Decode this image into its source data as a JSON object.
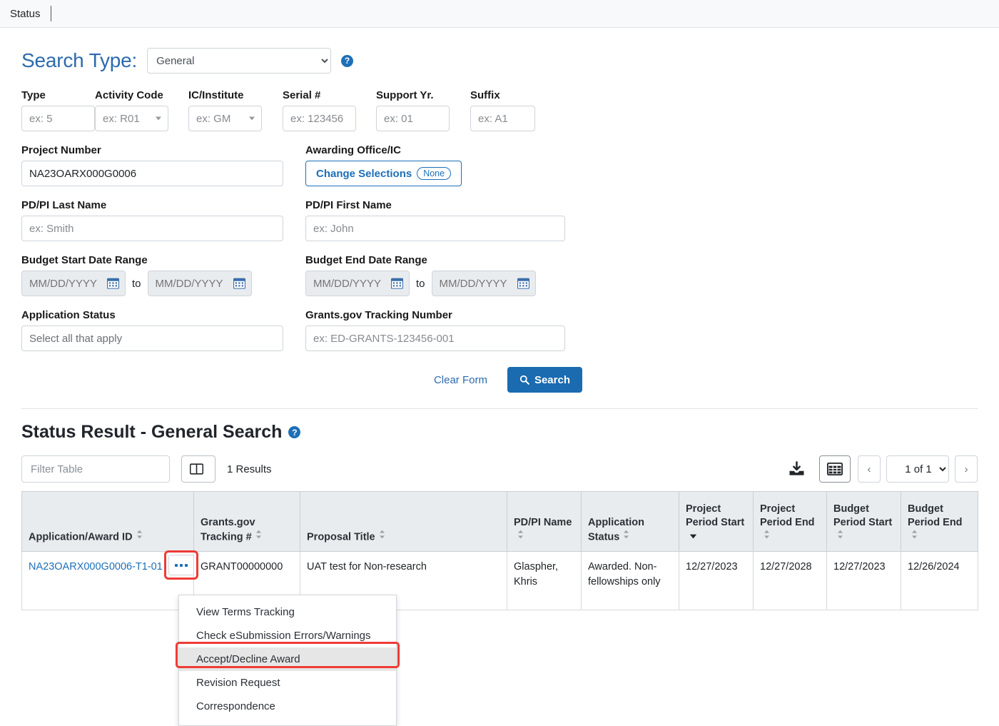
{
  "topbar": {
    "tab_label": "Status"
  },
  "search": {
    "heading": "Search Type:",
    "type_value": "General",
    "help_icon": "help-circle-icon",
    "fields": {
      "type": {
        "label": "Type",
        "placeholder": "ex: 5",
        "value": ""
      },
      "activity_code": {
        "label": "Activity Code",
        "placeholder": "ex: R01",
        "value": ""
      },
      "ic_institute": {
        "label": "IC/Institute",
        "placeholder": "ex: GM",
        "value": ""
      },
      "serial": {
        "label": "Serial #",
        "placeholder": "ex: 123456",
        "value": ""
      },
      "support_yr": {
        "label": "Support Yr.",
        "placeholder": "ex: 01",
        "value": ""
      },
      "suffix": {
        "label": "Suffix",
        "placeholder": "ex: A1",
        "value": ""
      },
      "project_number": {
        "label": "Project Number",
        "placeholder": "",
        "value": "NA23OARX000G0006"
      },
      "awarding_office": {
        "label": "Awarding Office/IC",
        "button_label": "Change Selections",
        "pill": "None"
      },
      "pdpi_last": {
        "label": "PD/PI Last Name",
        "placeholder": "ex: Smith",
        "value": ""
      },
      "pdpi_first": {
        "label": "PD/PI First Name",
        "placeholder": "ex: John",
        "value": ""
      },
      "budget_start": {
        "label": "Budget Start Date Range",
        "from_placeholder": "MM/DD/YYYY",
        "to_placeholder": "MM/DD/YYYY",
        "between": "to"
      },
      "budget_end": {
        "label": "Budget End Date Range",
        "from_placeholder": "MM/DD/YYYY",
        "to_placeholder": "MM/DD/YYYY",
        "between": "to"
      },
      "application_status": {
        "label": "Application Status",
        "value": "Select all that apply"
      },
      "grants_tracking": {
        "label": "Grants.gov Tracking Number",
        "placeholder": "ex: ED-GRANTS-123456-001",
        "value": ""
      }
    },
    "clear_label": "Clear Form",
    "search_label": "Search",
    "search_icon": "magnifier-icon"
  },
  "results": {
    "title": "Status Result - General Search",
    "help_icon": "help-circle-icon",
    "filter_placeholder": "Filter Table",
    "column_picker_icon": "columns-icon",
    "count_label": "1 Results",
    "download_icon": "download-icon",
    "grid_icon": "table-grid-icon",
    "prev_label": "‹",
    "next_label": "›",
    "page_value": "1 of 1",
    "columns": [
      {
        "label": "Application/Award ID",
        "sort": "none"
      },
      {
        "label": "Grants.gov Tracking #",
        "sort": "none"
      },
      {
        "label": "Proposal Title",
        "sort": "none"
      },
      {
        "label": "PD/PI Name",
        "sort": "none"
      },
      {
        "label": "Application Status",
        "sort": "none"
      },
      {
        "label": "Project Period Start",
        "sort": "desc"
      },
      {
        "label": "Project Period End",
        "sort": "none"
      },
      {
        "label": "Budget Period Start",
        "sort": "none"
      },
      {
        "label": "Budget Period End",
        "sort": "none"
      }
    ],
    "rows": [
      {
        "award_id": "NA23OARX000G0006-T1-01",
        "tracking": "GRANT00000000",
        "proposal_title": "UAT test for Non-research",
        "pdpi_name": "Glaspher, Khris",
        "app_status": "Awarded. Non-fellowships only",
        "project_start": "12/27/2023",
        "project_end": "12/27/2028",
        "budget_start": "12/27/2023",
        "budget_end": "12/26/2024"
      }
    ]
  },
  "context_menu": {
    "items": [
      {
        "label": "View Terms Tracking",
        "highlighted": false
      },
      {
        "label": "Check eSubmission Errors/Warnings",
        "highlighted": false
      },
      {
        "label": "Accept/Decline Award",
        "highlighted": true
      },
      {
        "label": "Revision Request",
        "highlighted": false
      },
      {
        "label": "Correspondence",
        "highlighted": false
      }
    ]
  },
  "colors": {
    "accent_blue": "#1d6fb8",
    "heading_blue": "#2c6bac",
    "annotation_red": "#ee3b36",
    "table_header_bg": "#e8ecef"
  }
}
